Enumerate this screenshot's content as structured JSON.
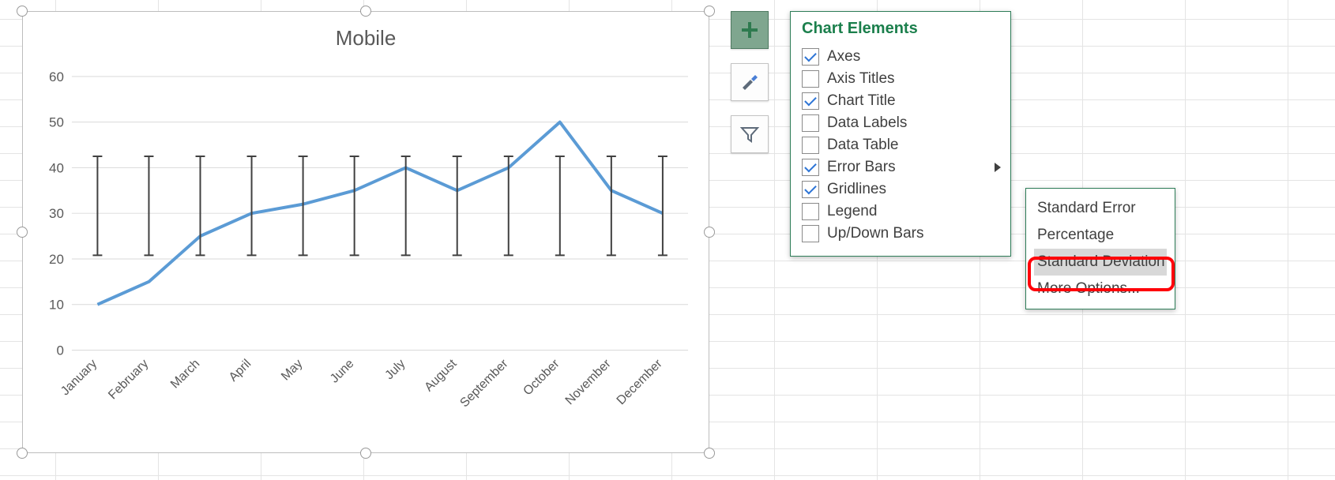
{
  "chart": {
    "title": "Mobile",
    "yticks": [
      "0",
      "10",
      "20",
      "30",
      "40",
      "50",
      "60"
    ]
  },
  "flyout": {
    "title": "Chart Elements",
    "items": [
      {
        "label": "Axes",
        "checked": true
      },
      {
        "label": "Axis Titles",
        "checked": false
      },
      {
        "label": "Chart Title",
        "checked": true
      },
      {
        "label": "Data Labels",
        "checked": false
      },
      {
        "label": "Data Table",
        "checked": false
      },
      {
        "label": "Error Bars",
        "checked": true,
        "arrow": true
      },
      {
        "label": "Gridlines",
        "checked": true
      },
      {
        "label": "Legend",
        "checked": false
      },
      {
        "label": "Up/Down Bars",
        "checked": false
      }
    ]
  },
  "submenu": {
    "items": [
      {
        "label": "Standard Error"
      },
      {
        "label": "Percentage"
      },
      {
        "label": "Standard Deviation",
        "highlight": true
      },
      {
        "label": "More Options..."
      }
    ]
  },
  "chart_data": {
    "type": "line",
    "title": "Mobile",
    "xlabel": "",
    "ylabel": "",
    "ylim": [
      0,
      60
    ],
    "categories": [
      "January",
      "February",
      "March",
      "April",
      "May",
      "June",
      "July",
      "August",
      "September",
      "October",
      "November",
      "December"
    ],
    "values": [
      10,
      15,
      25,
      30,
      32,
      35,
      40,
      35,
      40,
      50,
      35,
      30
    ],
    "error_bars": {
      "type": "standard_deviation",
      "center": 31.4,
      "low": 20.8,
      "high": 42.5
    }
  }
}
